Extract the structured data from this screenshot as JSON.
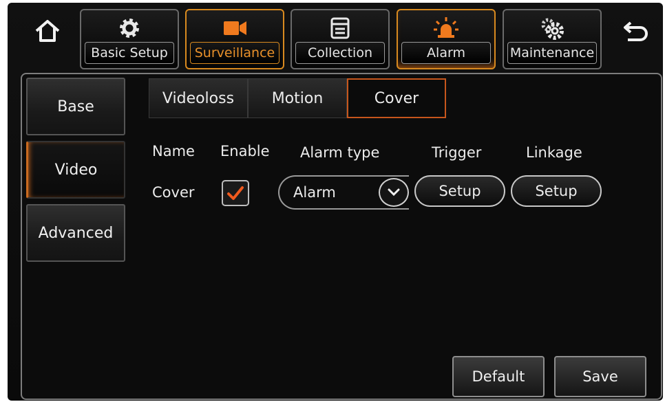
{
  "nav": {
    "tabs": [
      {
        "label": "Basic Setup",
        "icon": "gear-icon"
      },
      {
        "label": "Surveillance",
        "icon": "camera-icon"
      },
      {
        "label": "Collection",
        "icon": "collection-icon"
      },
      {
        "label": "Alarm",
        "icon": "alarm-icon"
      },
      {
        "label": "Maintenance",
        "icon": "maintenance-icon"
      }
    ],
    "active_tab": "Surveillance",
    "home_icon": "home-icon",
    "back_icon": "back-icon"
  },
  "sidebar": {
    "items": [
      {
        "label": "Base"
      },
      {
        "label": "Video"
      },
      {
        "label": "Advanced"
      }
    ],
    "active_item": "Video"
  },
  "subtabs": {
    "items": [
      {
        "label": "Videoloss"
      },
      {
        "label": "Motion"
      },
      {
        "label": "Cover"
      }
    ],
    "active_item": "Cover"
  },
  "table": {
    "headers": {
      "name": "Name",
      "enable": "Enable",
      "alarm_type": "Alarm type",
      "trigger": "Trigger",
      "linkage": "Linkage"
    },
    "row": {
      "name": "Cover",
      "enabled": true,
      "alarm_type": "Alarm",
      "trigger_button": "Setup",
      "linkage_button": "Setup"
    }
  },
  "footer": {
    "default_label": "Default",
    "save_label": "Save"
  },
  "colors": {
    "accent_orange": "#d98a1f",
    "check_orange": "#f05a1e",
    "background": "#0c0c0c"
  }
}
